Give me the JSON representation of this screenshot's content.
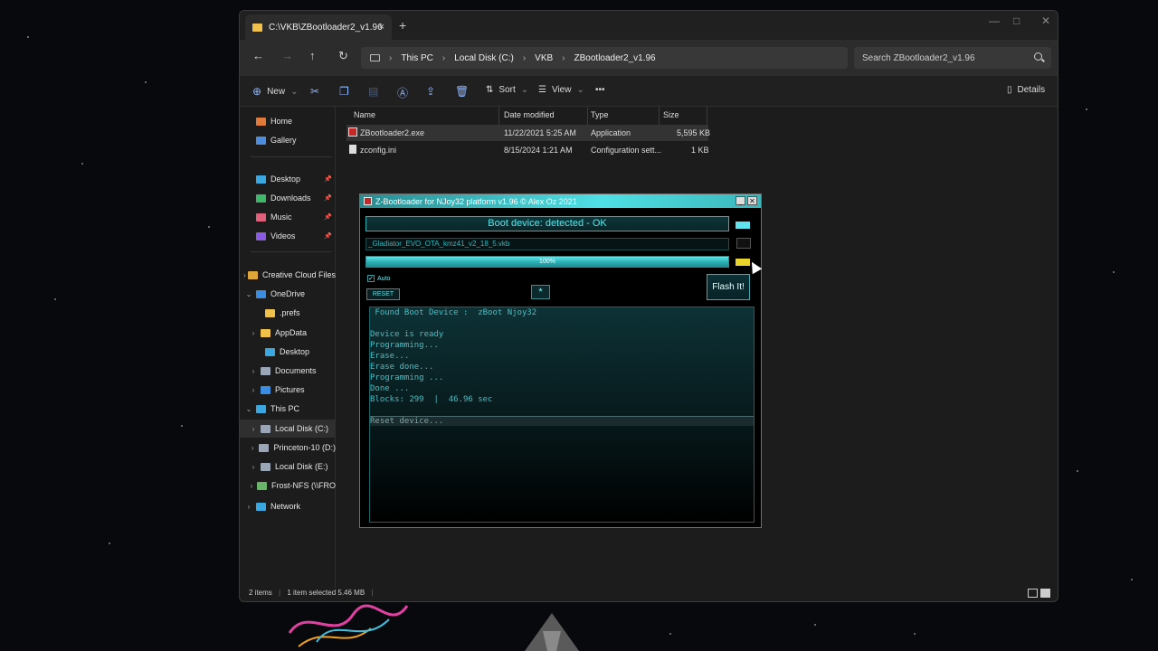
{
  "explorer": {
    "tab_title": "C:\\VKB\\ZBootloader2_v1.96",
    "tab_close": "×",
    "tab_add": "+",
    "win_min": "—",
    "win_max": "□",
    "win_close": "✕",
    "breadcrumbs": [
      "This PC",
      "Local Disk (C:)",
      "VKB",
      "ZBootloader2_v1.96"
    ],
    "search_placeholder": "Search ZBootloader2_v1.96",
    "toolbar": {
      "new_label": "New",
      "sort_label": "Sort",
      "view_label": "View",
      "more_label": "•••",
      "details_label": "Details"
    },
    "sidebar": {
      "items": [
        {
          "label": "Home",
          "color": "#e07a3a"
        },
        {
          "label": "Gallery",
          "color": "#4c8de0"
        },
        {
          "label": "Desktop",
          "color": "#3aa7e0"
        },
        {
          "label": "Downloads",
          "color": "#3fb76a"
        },
        {
          "label": "Music",
          "color": "#e0607a"
        },
        {
          "label": "Videos",
          "color": "#8a5ae0"
        },
        {
          "label": "Creative Cloud Files",
          "color": "#e0a63a"
        },
        {
          "label": "OneDrive",
          "color": "#3a8de0"
        },
        {
          "label": ".prefs",
          "color": "#f1c24b"
        },
        {
          "label": "AppData",
          "color": "#f1c24b"
        },
        {
          "label": "Desktop",
          "color": "#3aa7e0"
        },
        {
          "label": "Documents",
          "color": "#9aa5b5"
        },
        {
          "label": "Pictures",
          "color": "#3a8de0"
        },
        {
          "label": "This PC",
          "color": "#3aa7e0"
        },
        {
          "label": "Local Disk (C:)",
          "color": "#9aa5b5"
        },
        {
          "label": "Princeton-10 (D:)",
          "color": "#9aa5b5"
        },
        {
          "label": "Local Disk (E:)",
          "color": "#9aa5b5"
        },
        {
          "label": "Frost-NFS (\\\\FRO",
          "color": "#6ab36a"
        },
        {
          "label": "Network",
          "color": "#3aa7e0"
        }
      ]
    },
    "columns": [
      "Name",
      "Date modified",
      "Type",
      "Size"
    ],
    "files": [
      {
        "name": "ZBootloader2.exe",
        "date": "11/22/2021 5:25 AM",
        "type": "Application",
        "size": "5,595 KB",
        "selected": true
      },
      {
        "name": "zconfig.ini",
        "date": "8/15/2024 1:21 AM",
        "type": "Configuration sett...",
        "size": "1 KB",
        "selected": false
      }
    ],
    "status": {
      "items": "2 items",
      "selected": "1 item selected  5.46 MB"
    }
  },
  "zboot": {
    "title": "Z-Bootloader for NJoy32 platform v1.96 © Alex Oz 2021",
    "minimize": "_",
    "close": "✕",
    "status": "Boot device: detected - OK",
    "file": "_Gladiator_EVO_OTA_kmz41_v2_18_5.vkb",
    "progress_percent": 100,
    "progress_label": "100%",
    "auto_label": "Auto",
    "auto_check": "✓",
    "reset_label": "RESET",
    "star_label": "*",
    "flash_label": "Flash It!",
    "indicator_top_color": "#5fe3ee",
    "indicator_bottom_color": "#e9d52a",
    "console": [
      " Found Boot Device :  zBoot Njoy32",
      "",
      "Device is ready",
      "Programming...",
      "Erase...",
      "Erase done...",
      "Programming ...",
      "Done ...",
      "Blocks: 299  |  46.96 sec"
    ],
    "console_highlight": "Reset device..."
  }
}
